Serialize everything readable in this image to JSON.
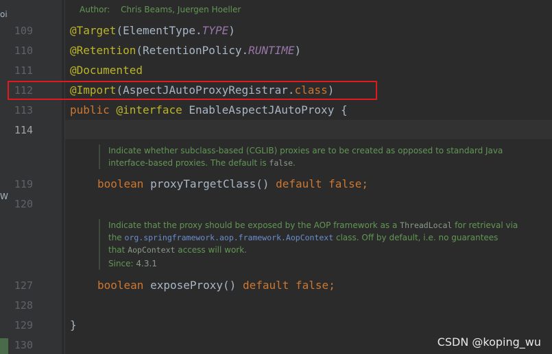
{
  "edge_labels": [
    "oi",
    "W"
  ],
  "author": {
    "label": "Author:",
    "names": "Chris Beams, Juergen Hoeller"
  },
  "line_numbers": [
    "109",
    "110",
    "111",
    "112",
    "113",
    "114",
    "119",
    "120",
    "127",
    "128",
    "129",
    "130"
  ],
  "code": {
    "l109_ann": "@Target",
    "l109_rest_a": "(ElementType.",
    "l109_const": "TYPE",
    "l109_rest_b": ")",
    "l110_ann": "@Retention",
    "l110_rest_a": "(RetentionPolicy.",
    "l110_const": "RUNTIME",
    "l110_rest_b": ")",
    "l111_ann": "@Documented",
    "l112_ann": "@Import",
    "l112_rest_a": "(AspectJAutoProxyRegistrar.",
    "l112_kw": "class",
    "l112_rest_b": ")",
    "l113_kw1": "public",
    "l113_ann": "@interface",
    "l113_rest": " EnableAspectJAutoProxy {",
    "l119_kw1": "boolean",
    "l119_mid": " proxyTargetClass() ",
    "l119_kw2": "default",
    "l119_sp": " ",
    "l119_kw3": "false",
    "l119_end": ";",
    "l127_kw1": "boolean",
    "l127_mid": " exposeProxy() ",
    "l127_kw2": "default",
    "l127_sp": " ",
    "l127_kw3": "false",
    "l127_end": ";",
    "l129": "}"
  },
  "doc1": {
    "line1": "Indicate whether subclass-based (CGLIB) proxies are to be created as opposed to standard Java",
    "line2_a": "interface-based proxies. The default is ",
    "line2_code": "false",
    "line2_b": "."
  },
  "doc2": {
    "line1_a": "Indicate that the proxy should be exposed by the AOP framework as a ",
    "line1_code": "ThreadLocal",
    "line1_b": " for retrieval via",
    "line2_a": "the ",
    "line2_link": "org.springframework.aop.framework.AopContext",
    "line2_b": " class. Off by default, i.e. no guarantees",
    "line3_a": "that ",
    "line3_code": "AopContext",
    "line3_b": " access will work.",
    "since_label": "Since:",
    "since_value": "4.3.1"
  },
  "watermark": "CSDN @koping_wu",
  "colors": {
    "highlight_box": "#e0191f",
    "background": "#2b2b2b",
    "annotation": "#bbb529",
    "keyword": "#cc7832"
  }
}
